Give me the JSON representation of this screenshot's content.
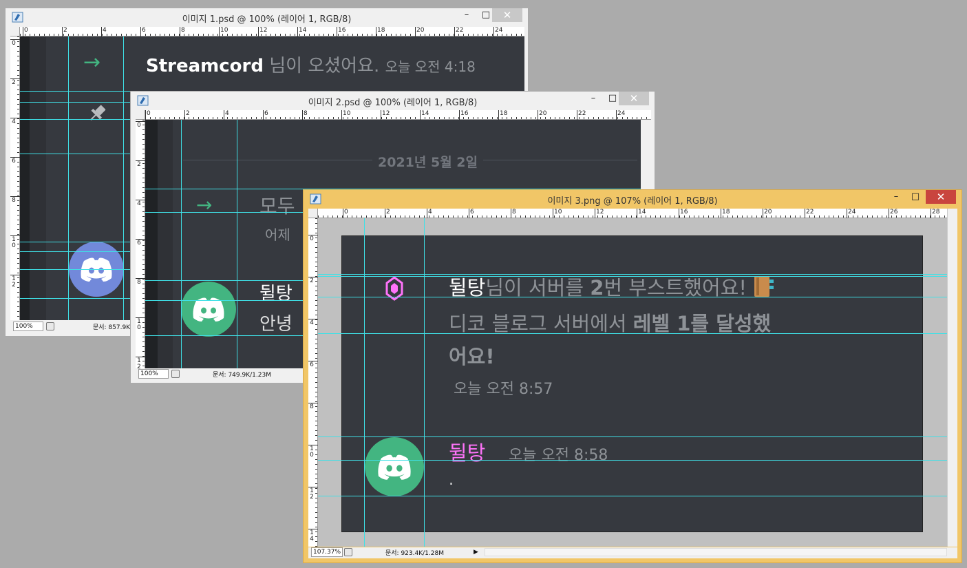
{
  "windows": {
    "w1": {
      "title": "이미지 1.psd @ 100% (레이어 1, RGB/8)",
      "zoom": "100%",
      "docinfo": "문서: 857.9K/1..."
    },
    "w2": {
      "title": "이미지 2.psd @ 100% (레이어 1, RGB/8)",
      "zoom": "100%",
      "docinfo": "문서: 749.9K/1.23M"
    },
    "w3": {
      "title": "이미지 3.png @ 107% (레이어 1, RGB/8)",
      "zoom": "107.37%",
      "docinfo": "문서: 923.4K/1.28M"
    }
  },
  "window_controls": {
    "minimize": "–",
    "maximize": "□",
    "close": "✕"
  },
  "rulers": {
    "w1_h": [
      "0",
      "2",
      "4",
      "6",
      "8",
      "10",
      "12",
      "14",
      "16",
      "18",
      "20",
      "22",
      "24"
    ],
    "w1_v": [
      "0",
      "2",
      "4",
      "6",
      "8",
      "10",
      "12"
    ],
    "w2_h": [
      "0",
      "2",
      "4",
      "6",
      "8",
      "10",
      "12",
      "14",
      "16",
      "18",
      "20",
      "22",
      "24"
    ],
    "w2_v": [
      "0",
      "2",
      "4",
      "6",
      "8",
      "10",
      "12"
    ],
    "w3_h": [
      "0",
      "2",
      "4",
      "6",
      "8",
      "10",
      "12",
      "14",
      "16",
      "18",
      "20",
      "22",
      "24",
      "26",
      "28"
    ],
    "w3_v": [
      "0",
      "2",
      "4",
      "6",
      "8",
      "10",
      "12",
      "14"
    ]
  },
  "w1": {
    "name": "Streamcord",
    "joined": "님이 오셨어요.",
    "time": "오늘 오전 4:18"
  },
  "w2": {
    "date": "2021년 5월 2일",
    "line1": "모두",
    "line2": "어제",
    "name": "뒬탕",
    "msg": "안녕"
  },
  "w3": {
    "boost_user": "뒬탕",
    "boost_text_a": "님이 서버를 ",
    "boost_count": "2",
    "boost_text_b": "번 부스트했어요!",
    "line2_a": "디코 블로그 서버에서 ",
    "line2_b": "레벨 1를 달성했",
    "line3": "어요!",
    "boost_time": "오늘 오전 8:57",
    "msg_user": "뒬탕",
    "msg_time": "오늘 오전 8:58",
    "msg_text": "."
  },
  "colors": {
    "discord_bg": "#36393f",
    "green": "#43b581",
    "blurple": "#7289da",
    "boost_pink": "#ff73fa",
    "guide": "#3fe0e6",
    "active_frame": "#f1c667"
  },
  "icons": [
    "photoshop-icon",
    "arrow-right-icon",
    "pin-icon",
    "discord-avatar-icon",
    "boost-gem-icon",
    "book-emoji-icon"
  ]
}
